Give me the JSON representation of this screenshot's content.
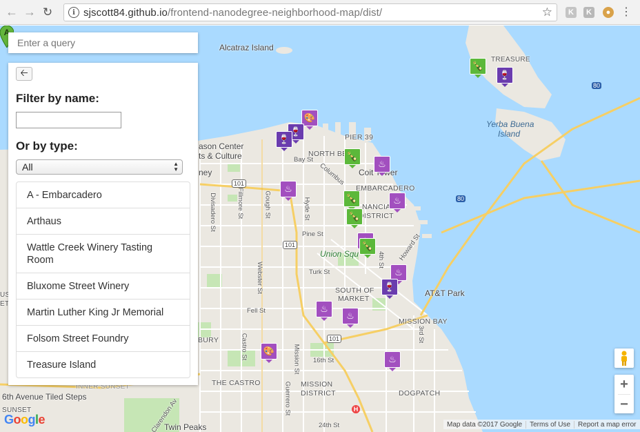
{
  "browser": {
    "url_host": "sjscott84.github.io",
    "url_path": "/frontend-nanodegree-neighborhood-map/dist/"
  },
  "search": {
    "placeholder": "Enter a query"
  },
  "panel": {
    "filter_name_label": "Filter by name:",
    "filter_type_label": "Or by type:",
    "type_selected": "All",
    "locations": [
      "A - Embarcadero",
      "Arthaus",
      "Wattle Creek Winery Tasting Room",
      "Bluxome Street Winery",
      "Martin Luther King Jr Memorial",
      "Folsom Street Foundry",
      "Treasure Island"
    ]
  },
  "map_labels": {
    "alcatraz": "Alcatraz Island",
    "treasure": "TREASURE",
    "yerba_buena": "Yerba Buena",
    "yerba_buena2": "Island",
    "pier39": "PIER 39",
    "north_beach": "NORTH BE",
    "coit": "Coit Tower",
    "embarcadero": "EMBARCADERO",
    "financial": "NANCIAL",
    "district": "DISTRICT",
    "union_sq": "Union Squ",
    "south_market": "SOUTH OF",
    "south_market2": "MARKET",
    "att_park": "AT&T Park",
    "mission_bay": "MISSION BAY",
    "castro": "THE CASTRO",
    "mission": "MISSION",
    "mission2": "DISTRICT",
    "dogpatch": "DOGPATCH",
    "twin_peaks": "Twin Peaks",
    "tiled_steps": "6th Avenue Tiled Steps",
    "sunset": "SUNSET",
    "inner_sunset": "INNER SUNSET",
    "usun": "USUN",
    "et": "ET",
    "bury": "BURY",
    "ason_center": "ason Center",
    "culture": "ts & Culture",
    "ney": "ney",
    "bay_st": "Bay St",
    "columbus": "Columbus",
    "pine_st": "Pine St",
    "turk_st": "Turk St",
    "fell_st": "Fell St",
    "castro_st": "Castro St",
    "mission_st": "Mission St",
    "guerrero_st": "Guerrero St",
    "16th_st": "16th St",
    "24th_st": "24th St",
    "3rd_st": "3rd St",
    "4th_st": "4th St",
    "howard_st": "Howard St",
    "divisadero": "Divisadero St",
    "fillmore": "Fillmore St",
    "webster": "Webster St",
    "gough": "Gough St",
    "hyde": "Hyde St",
    "clarendon": "Clarendon Av",
    "shield_101": "101",
    "shield_80": "80"
  },
  "map_footer": {
    "data": "Map data ©2017 Google",
    "terms": "Terms of Use",
    "report": "Report a map error"
  },
  "marker_a": "A",
  "colors": {
    "water": "#aadaff",
    "land": "#ebe8e1",
    "winery_marker": "#5cb83a",
    "art_marker": "#a24fbf",
    "bar_marker": "#6a3cae"
  }
}
